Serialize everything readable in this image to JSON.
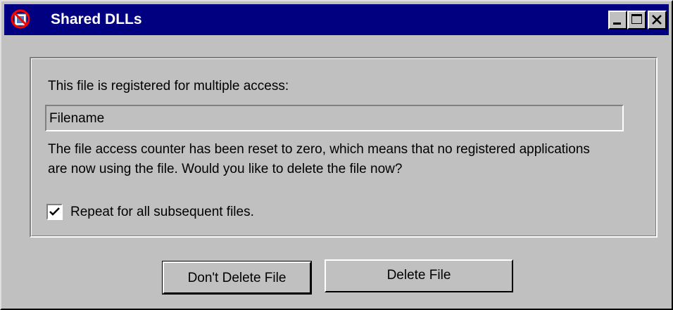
{
  "window": {
    "title": "Shared DLLs",
    "app_icon": "no-entry-icon"
  },
  "titlebar_buttons": {
    "minimize_icon": "minimize-icon",
    "maximize_icon": "maximize-icon",
    "close_icon": "close-icon"
  },
  "dialog": {
    "prompt": "This file is registered for multiple access:",
    "filename_value": "Filename",
    "message": "The file access counter has been reset to zero, which means that no registered applications are now using the file. Would you like to delete the file now?",
    "checkbox_label": "Repeat for all subsequent files.",
    "checkbox_checked": true
  },
  "buttons": {
    "dont_delete_label": "Don't Delete File",
    "delete_label": "Delete File"
  },
  "colors": {
    "titlebar": "#000080",
    "face": "#c0c0c0"
  }
}
